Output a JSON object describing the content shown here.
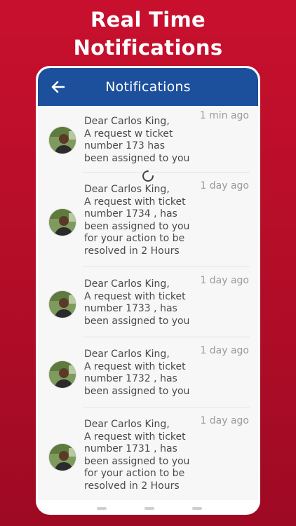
{
  "hero": {
    "line1": "Real Time",
    "line2": "Notifications"
  },
  "appbar": {
    "title": "Notifications",
    "back_icon": "arrow-left-icon"
  },
  "notifications": [
    {
      "lines": [
        "Dear Carlos King,",
        "A request w   ticket",
        "number 173   has",
        "been assigned to you"
      ],
      "time": "1 min ago",
      "loading": true
    },
    {
      "lines": [
        "Dear Carlos King,",
        "A request with ticket",
        "number 1734 , has",
        "been assigned to you",
        "for your action to be",
        "resolved in 2 Hours"
      ],
      "time": "1 day ago"
    },
    {
      "lines": [
        "Dear Carlos King,",
        "A request with ticket",
        "number 1733 , has",
        "been assigned to you"
      ],
      "time": "1 day ago"
    },
    {
      "lines": [
        "Dear Carlos King,",
        "A request with ticket",
        "number 1732 , has",
        "been assigned to you"
      ],
      "time": "1 day ago"
    },
    {
      "lines": [
        "Dear Carlos King,",
        "A request with ticket",
        "number 1731 , has",
        "been assigned to you",
        "for your action to be",
        "resolved in 2 Hours"
      ],
      "time": "1 day ago"
    }
  ],
  "colors": {
    "background": "#c8102e",
    "appbar": "#1c4f9c",
    "list_bg": "#f7f7f7",
    "time_text": "#9a9a9a"
  }
}
